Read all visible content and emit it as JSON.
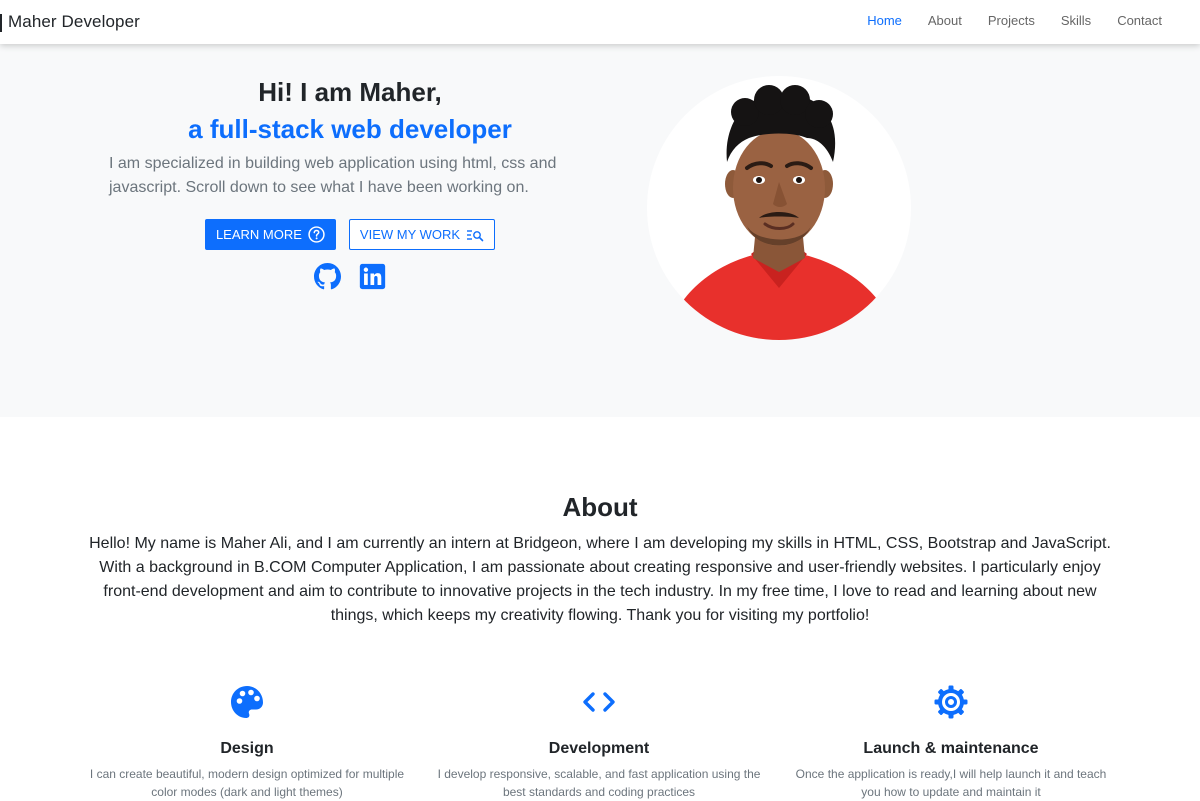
{
  "navbar": {
    "brand": "Maher Developer",
    "links": [
      "Home",
      "About",
      "Projects",
      "Skills",
      "Contact"
    ],
    "active": "Home"
  },
  "hero": {
    "greeting": "Hi! I am Maher,",
    "role": "a full-stack web developer",
    "description": "I am specialized in building web application using html, css and javascript. Scroll down to see what I have been working on.",
    "learn_more_label": "LEARN MORE",
    "view_work_label": "VIEW MY WORK",
    "learn_more_icon": "question-circle-icon",
    "view_work_icon": "search-list-icon",
    "socials": [
      "github-icon",
      "linkedin-icon"
    ]
  },
  "about": {
    "title": "About",
    "text": "Hello! My name is Maher Ali, and I am currently an intern at Bridgeon, where I am developing my skills in HTML, CSS, Bootstrap and JavaScript. With a background in B.COM Computer Application, I am passionate about creating responsive and user-friendly websites. I particularly enjoy front-end development and aim to contribute to innovative projects in the tech industry. In my free time, I love to read and learning about new things, which keeps my creativity flowing. Thank you for visiting my portfolio!"
  },
  "features": [
    {
      "icon": "palette-icon",
      "title": "Design",
      "desc": "I can create beautiful, modern design optimized for multiple color modes (dark and light themes)"
    },
    {
      "icon": "code-icon",
      "title": "Development",
      "desc": "I develop responsive, scalable, and fast application using the best standards and coding practices"
    },
    {
      "icon": "gear-icon",
      "title": "Launch & maintenance",
      "desc": "Once the application is ready,I will help launch it and teach you how to update and maintain it"
    }
  ],
  "colors": {
    "accent": "#0d6efd",
    "hero_bg": "#f8f9fa",
    "shirt": "#e8302c"
  }
}
